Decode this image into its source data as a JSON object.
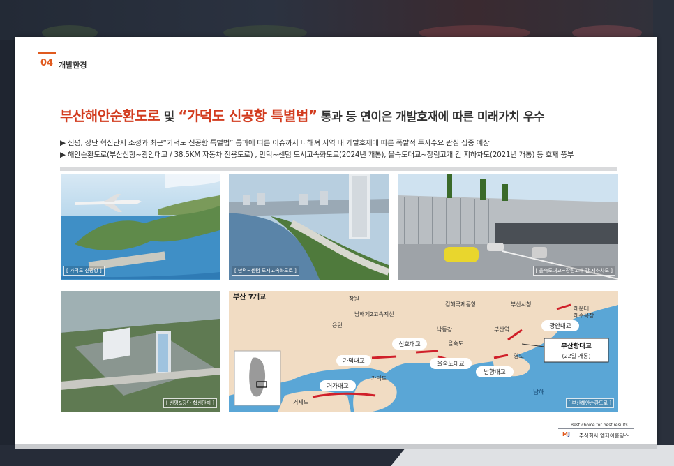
{
  "section": {
    "number": "04",
    "title": "개발환경"
  },
  "headline": {
    "part1": "부산해안순환도로",
    "part2": " 및 ",
    "part3": "“가덕도 신공항 특별법”",
    "part4": " 통과 등 연이은 개발호재에 따른 미래가치 우수"
  },
  "bullets": [
    "▶ 신평, 장단 혁신단지 조성과 최근“가덕도 신공항 특별법” 통과에 따른 이슈까지 더해져 지역 내 개발호재에 따른 폭발적 투자수요 관심 집중 예상",
    "▶ 해안순환도로(부산신항~광안대교 / 38.5KM 자동차 전용도로) , 만덕~센텀 도시고속화도로(2024년 개통), 을숙도대교~장림고개 간 지하차도(2021년 개통) 등 호재 풍부"
  ],
  "photos": {
    "airport": "[ 가덕도 신공항 ]",
    "expressway": "[ 만덕~센텀 도시고속화도로 ]",
    "tunnel": "[ 을숙도대교~장림고개 간 지하차도 ]",
    "complex": "[ 신평&장단 혁신단지 ]"
  },
  "map": {
    "title": "부산 7개교",
    "caption": "[ 부산해안순환도로 ]",
    "places": {
      "changwon": "창원",
      "gimhae_airport": "김해국제공항",
      "busan_city_hall": "부산시청",
      "haeundae": "해운대",
      "haeundae2": "해수욕장",
      "namhae2": "남해제2고속지선",
      "yongwon": "용원",
      "nakdong": "낙동강",
      "busan_station": "부산역",
      "eulsukdo": "을숙도",
      "gadeok": "가덕도",
      "yeongdo": "영도",
      "geoje": "거제도",
      "namhae_sea": "남해"
    },
    "bridges": {
      "gwangan": "광안대교",
      "sinho": "신호대교",
      "gadeok": "가덕대교",
      "eulsukdo": "을숙도대교",
      "namhang": "남항대교",
      "geoga": "거가대교",
      "busanhang": "부산항대교",
      "busanhang_note": "(22일 개통)"
    }
  },
  "footer": {
    "tagline": "Best choice for best results",
    "logo_m": "M",
    "logo_j": "J",
    "company": "주식회사 엠제이홀딩스"
  },
  "colors": {
    "accent": "#d23b1e",
    "sea": "#5aa6d6",
    "land": "#f1dcc3",
    "road": "#d0202a"
  }
}
